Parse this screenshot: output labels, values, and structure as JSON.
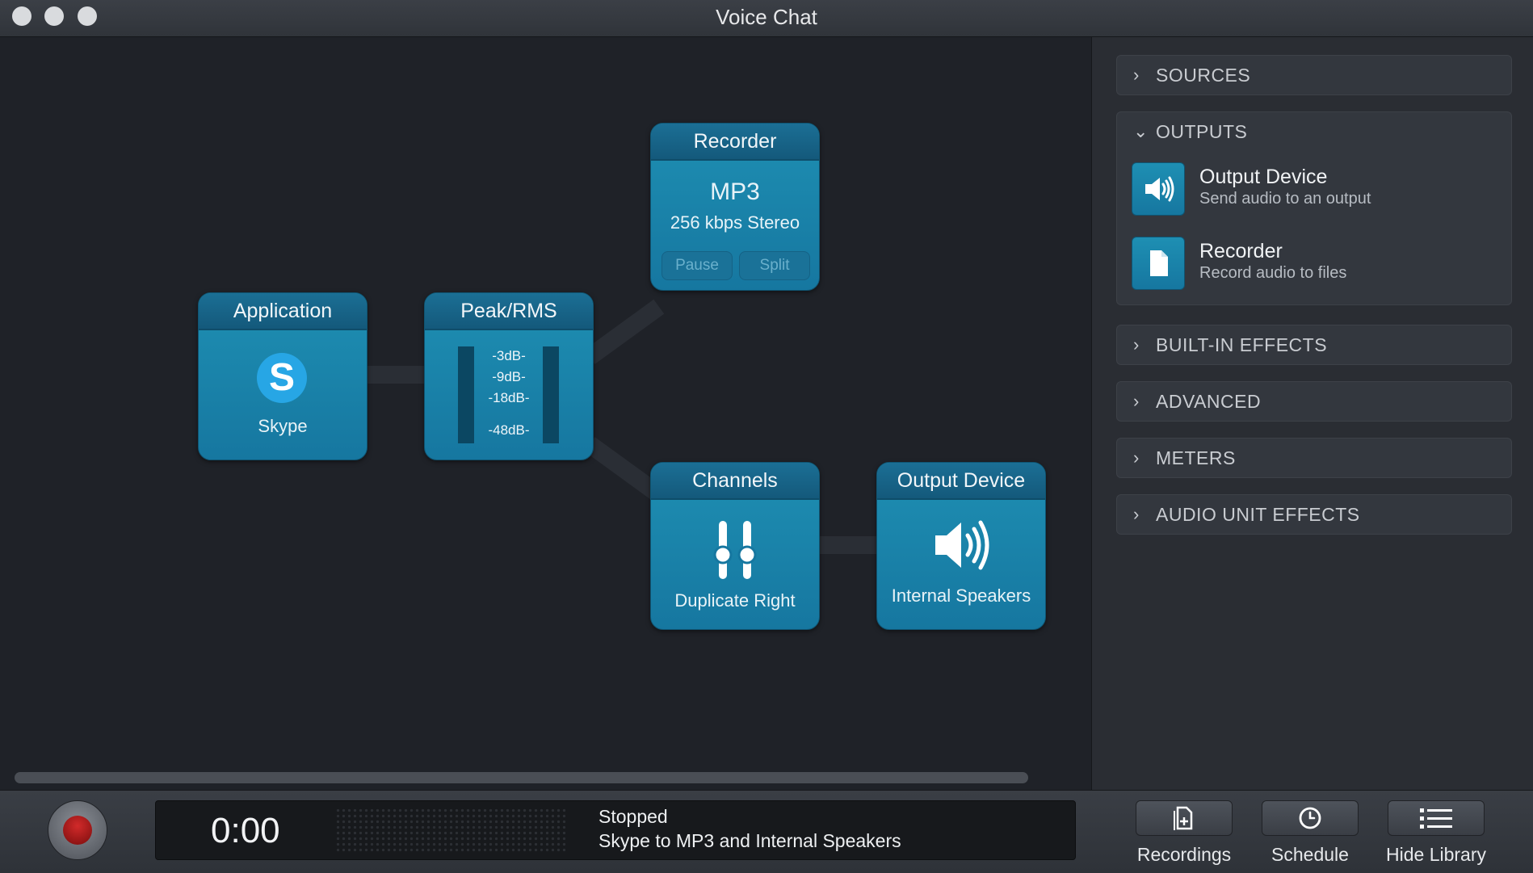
{
  "window": {
    "title": "Voice Chat"
  },
  "nodes": {
    "application": {
      "title": "Application",
      "source": "Skype",
      "logo_letter": "S"
    },
    "peak_rms": {
      "title": "Peak/RMS",
      "levels": [
        "-3dB-",
        "-9dB-",
        "-18dB-",
        "-48dB-"
      ]
    },
    "recorder": {
      "title": "Recorder",
      "format": "MP3",
      "quality": "256 kbps Stereo",
      "pause_label": "Pause",
      "split_label": "Split"
    },
    "channels": {
      "title": "Channels",
      "mode": "Duplicate Right"
    },
    "output_device": {
      "title": "Output Device",
      "device": "Internal Speakers"
    }
  },
  "library": {
    "sections": [
      {
        "label": "SOURCES",
        "expanded": false
      },
      {
        "label": "OUTPUTS",
        "expanded": true
      },
      {
        "label": "BUILT-IN EFFECTS",
        "expanded": false
      },
      {
        "label": "ADVANCED",
        "expanded": false
      },
      {
        "label": "METERS",
        "expanded": false
      },
      {
        "label": "AUDIO UNIT EFFECTS",
        "expanded": false
      }
    ],
    "outputs": [
      {
        "name": "Output Device",
        "desc": "Send audio to an output",
        "icon": "speaker-icon"
      },
      {
        "name": "Recorder",
        "desc": "Record audio to files",
        "icon": "document-icon"
      }
    ]
  },
  "bottom": {
    "timer": "0:00",
    "status": "Stopped",
    "summary": "Skype to MP3 and Internal Speakers",
    "tools": {
      "recordings": "Recordings",
      "schedule": "Schedule",
      "hide_library": "Hide Library"
    }
  },
  "colors": {
    "node_blue": "#1a85ad",
    "record_red": "#c62020",
    "canvas_bg": "#1f2228"
  }
}
